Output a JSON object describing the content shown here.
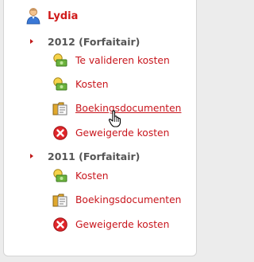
{
  "user": {
    "name": "Lydia",
    "icon": "user-icon"
  },
  "groups": [
    {
      "year_label": "2012 (Forfaitair)",
      "items": [
        {
          "label": "Te valideren kosten",
          "icon": "money-icon"
        },
        {
          "label": "Kosten",
          "icon": "money-icon"
        },
        {
          "label": "Boekingsdocumenten",
          "icon": "folder-document-icon"
        },
        {
          "label": "Geweigerde kosten",
          "icon": "reject-icon"
        }
      ]
    },
    {
      "year_label": "2011 (Forfaitair)",
      "items": [
        {
          "label": "Kosten",
          "icon": "money-icon"
        },
        {
          "label": "Boekingsdocumenten",
          "icon": "folder-document-icon"
        },
        {
          "label": "Geweigerde kosten",
          "icon": "reject-icon"
        }
      ]
    }
  ],
  "colors": {
    "link": "#c8161d",
    "user_name": "#d01a1a",
    "year": "#555555",
    "arrow": "#c01818"
  }
}
